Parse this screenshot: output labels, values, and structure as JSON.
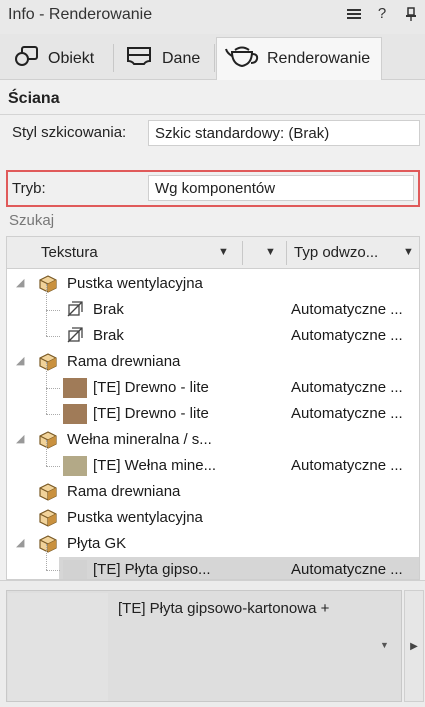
{
  "window": {
    "title": "Info - Renderowanie",
    "menu_icon": "hamburger-icon",
    "help_label": "?",
    "pin_icon": "pin-icon"
  },
  "tabs": [
    {
      "label": "Obiekt",
      "icon": "object-icon"
    },
    {
      "label": "Dane",
      "icon": "data-icon"
    },
    {
      "label": "Renderowanie",
      "icon": "teapot-icon",
      "active": true
    }
  ],
  "section": {
    "title": "Ściana"
  },
  "fields": {
    "style": {
      "label": "Styl szkicowania:",
      "value": "Szkic standardowy: (Brak)"
    },
    "mode": {
      "label": "Tryb:",
      "value": "Wg komponentów"
    }
  },
  "search": {
    "label": "Szukaj"
  },
  "table": {
    "columns": [
      "Tekstura",
      "Typ odwzo..."
    ],
    "rows": [
      {
        "level": 0,
        "kind": "component",
        "expandable": true,
        "name": "Pustka wentylacyjna",
        "type": ""
      },
      {
        "level": 1,
        "kind": "none",
        "name": "Brak",
        "type": "Automatyczne ..."
      },
      {
        "level": 1,
        "kind": "none",
        "name": "Brak",
        "type": "Automatyczne ..."
      },
      {
        "level": 0,
        "kind": "component",
        "expandable": true,
        "name": "Rama drewniana",
        "type": ""
      },
      {
        "level": 1,
        "kind": "texture",
        "swatch": "#a07b58",
        "name": "[TE] Drewno - lite",
        "type": "Automatyczne ..."
      },
      {
        "level": 1,
        "kind": "texture",
        "swatch": "#a07b58",
        "name": "[TE] Drewno - lite",
        "type": "Automatyczne ..."
      },
      {
        "level": 0,
        "kind": "component",
        "expandable": true,
        "name": "Wełna mineralna / s...",
        "type": ""
      },
      {
        "level": 1,
        "kind": "texture",
        "swatch": "#b3a987",
        "name": "[TE] Wełna mine...",
        "type": "Automatyczne ..."
      },
      {
        "level": 0,
        "kind": "component",
        "expandable": false,
        "name": "Rama drewniana",
        "type": ""
      },
      {
        "level": 0,
        "kind": "component",
        "expandable": false,
        "name": "Pustka wentylacyjna",
        "type": ""
      },
      {
        "level": 0,
        "kind": "component",
        "expandable": true,
        "name": "Płyta GK",
        "type": ""
      },
      {
        "level": 1,
        "kind": "texture",
        "swatch": "#d2d2d2",
        "name": "[TE] Płyta gipso...",
        "type": "Automatyczne ...",
        "selected": true
      }
    ]
  },
  "preview": {
    "label": "[TE] Płyta gipsowo-kartonowa +",
    "swatch_color": "#e2e2e2"
  },
  "colors": {
    "highlight": "#e05a5a",
    "selected_row": "#d6d6d6",
    "component_icon": "#c9913f"
  }
}
